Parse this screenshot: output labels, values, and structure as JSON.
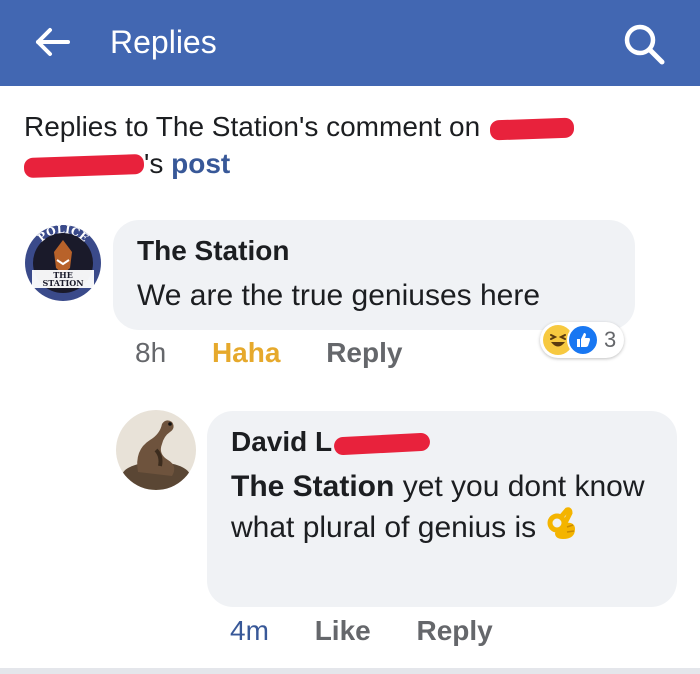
{
  "header": {
    "title": "Replies",
    "back_icon": "back-arrow-icon",
    "search_icon": "search-icon",
    "bar_color": "#4267b2"
  },
  "context": {
    "prefix": "Replies to The Station's comment on",
    "possessive": "'s",
    "post_link": "post"
  },
  "comment": {
    "author": "The Station",
    "avatar_text_top": "POLICE",
    "avatar_text_bottom_1": "THE",
    "avatar_text_bottom_2": "STATION",
    "text": "We are the true geniuses here",
    "time": "8h",
    "reaction_action": "Haha",
    "reply_label": "Reply",
    "reaction_count": "3",
    "reactions": [
      "haha-icon",
      "like-icon"
    ]
  },
  "reply": {
    "author_visible": "David L",
    "mention": "The Station",
    "text": "yet you dont know what plural of genius is",
    "emoji": "ok-hand-icon",
    "time": "4m",
    "like_label": "Like",
    "reply_label": "Reply"
  },
  "colors": {
    "link": "#385898",
    "haha": "#e6a92c",
    "redaction": "#e8223c",
    "bubble": "#f0f2f5"
  }
}
